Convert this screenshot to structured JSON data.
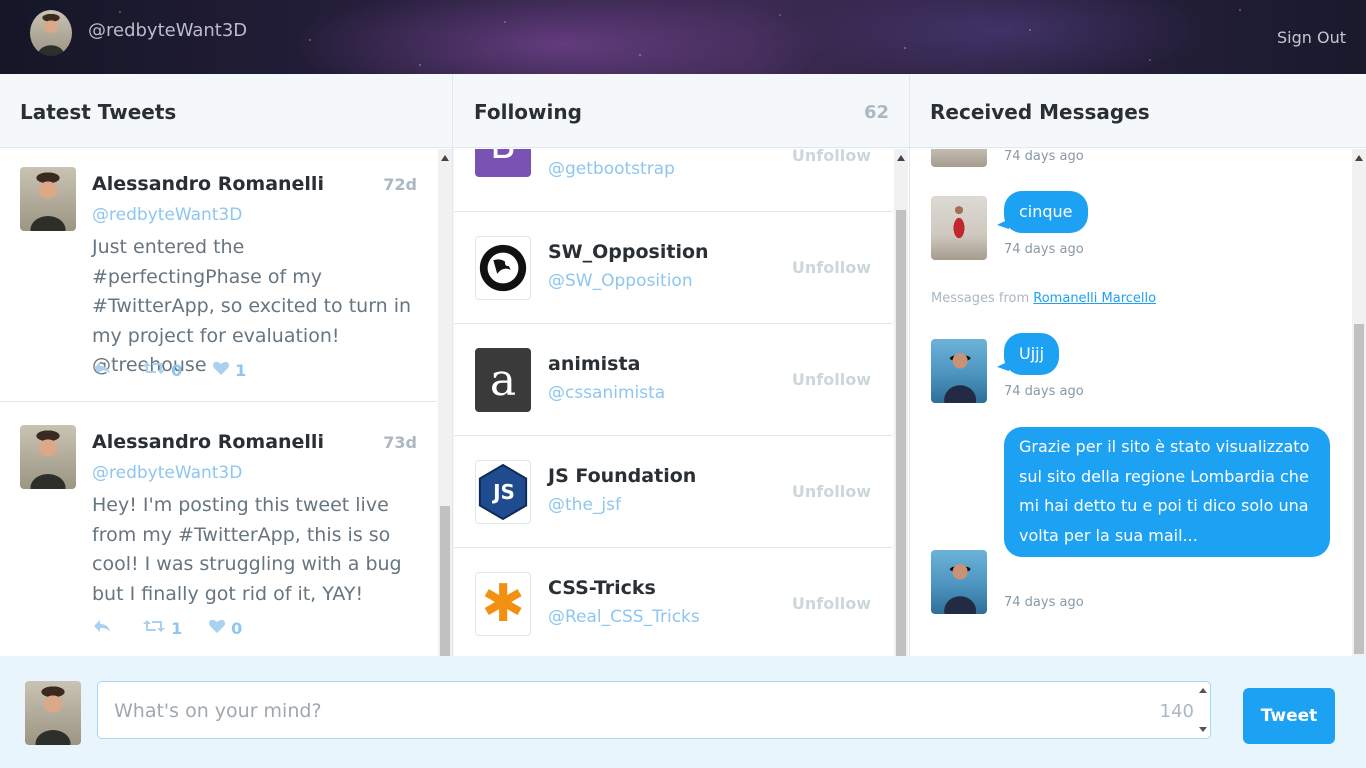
{
  "header": {
    "handle": "@redbyteWant3D",
    "sign_out": "Sign Out"
  },
  "columns": {
    "tweets": {
      "title": "Latest Tweets"
    },
    "following": {
      "title": "Following",
      "count": "62"
    },
    "messages": {
      "title": "Received Messages"
    }
  },
  "tweets": [
    {
      "name": "Alessandro Romanelli",
      "handle": "@redbyteWant3D",
      "when": "72d",
      "text": "Just entered the #perfectingPhase of my #TwitterApp, so excited to turn in my project for evaluation! @treehouse",
      "retweets": "0",
      "likes": "1"
    },
    {
      "name": "Alessandro Romanelli",
      "handle": "@redbyteWant3D",
      "when": "73d",
      "text": "Hey! I'm posting this tweet live from my #TwitterApp, this is so cool! I was struggling with a bug but I finally got rid of it, YAY!",
      "retweets": "1",
      "likes": "0"
    }
  ],
  "following": [
    {
      "name": "",
      "handle": "@getbootstrap",
      "logo_text": "B",
      "action": "Unfollow"
    },
    {
      "name": "SW_Opposition",
      "handle": "@SW_Opposition",
      "logo_text": "",
      "action": "Unfollow"
    },
    {
      "name": "animista",
      "handle": "@cssanimista",
      "logo_text": "a",
      "action": "Unfollow"
    },
    {
      "name": "JS Foundation",
      "handle": "@the_jsf",
      "logo_text": "JS",
      "action": "Unfollow"
    },
    {
      "name": "CSS-Tricks",
      "handle": "@Real_CSS_Tricks",
      "logo_text": "✱",
      "action": "Unfollow"
    }
  ],
  "messages": {
    "items": [
      {
        "text": "",
        "time": "74 days ago"
      },
      {
        "text": "cinque",
        "time": "74 days ago"
      },
      {
        "text": "Ujjj",
        "time": "74 days ago"
      },
      {
        "text": "Grazie per il sito è stato visualizzato sul sito della regione Lombardia che mi hai detto tu e poi ti dico solo una volta per la sua mail...",
        "time": "74 days ago"
      }
    ],
    "from_label": "Messages from",
    "from_name": "Romanelli Marcello"
  },
  "composer": {
    "placeholder": "What's on your mind?",
    "counter": "140",
    "button": "Tweet"
  },
  "colors": {
    "accent": "#1da1f2",
    "handle": "#8ec6ef"
  }
}
